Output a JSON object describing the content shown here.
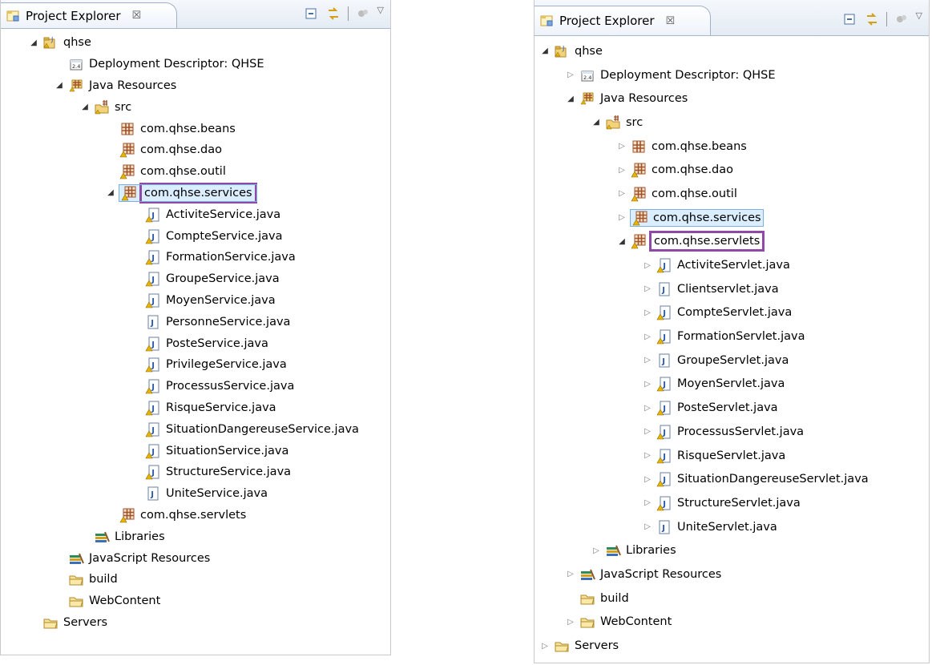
{
  "left_panel": {
    "tab_title": "Project Explorer",
    "tab_close": "☒",
    "tree": [
      {
        "level": 0,
        "toggle": "open",
        "icon": "project-icon",
        "label": "qhse"
      },
      {
        "level": 1,
        "toggle": "none",
        "icon": "deployment-descriptor-icon",
        "label": "Deployment Descriptor: QHSE"
      },
      {
        "level": 1,
        "toggle": "open",
        "icon": "java-resources-icon",
        "label": "Java Resources"
      },
      {
        "level": 2,
        "toggle": "open",
        "icon": "source-folder-icon",
        "label": "src"
      },
      {
        "level": 3,
        "toggle": "none",
        "icon": "package-icon",
        "label": "com.qhse.beans"
      },
      {
        "level": 3,
        "toggle": "none",
        "icon": "package-warning-icon",
        "label": "com.qhse.dao"
      },
      {
        "level": 3,
        "toggle": "none",
        "icon": "package-warning-icon",
        "label": "com.qhse.outil"
      },
      {
        "level": 3,
        "toggle": "open",
        "icon": "package-warning-icon",
        "label": "com.qhse.services",
        "selected": true,
        "highlight": true
      },
      {
        "level": 4,
        "toggle": "none",
        "icon": "java-file-warning-icon",
        "label": "ActiviteService.java"
      },
      {
        "level": 4,
        "toggle": "none",
        "icon": "java-file-warning-icon",
        "label": "CompteService.java"
      },
      {
        "level": 4,
        "toggle": "none",
        "icon": "java-file-warning-icon",
        "label": "FormationService.java"
      },
      {
        "level": 4,
        "toggle": "none",
        "icon": "java-file-warning-icon",
        "label": "GroupeService.java"
      },
      {
        "level": 4,
        "toggle": "none",
        "icon": "java-file-warning-icon",
        "label": "MoyenService.java"
      },
      {
        "level": 4,
        "toggle": "none",
        "icon": "java-file-icon",
        "label": "PersonneService.java"
      },
      {
        "level": 4,
        "toggle": "none",
        "icon": "java-file-warning-icon",
        "label": "PosteService.java"
      },
      {
        "level": 4,
        "toggle": "none",
        "icon": "java-file-warning-icon",
        "label": "PrivilegeService.java"
      },
      {
        "level": 4,
        "toggle": "none",
        "icon": "java-file-warning-icon",
        "label": "ProcessusService.java"
      },
      {
        "level": 4,
        "toggle": "none",
        "icon": "java-file-warning-icon",
        "label": "RisqueService.java"
      },
      {
        "level": 4,
        "toggle": "none",
        "icon": "java-file-warning-icon",
        "label": "SituationDangereuseService.java"
      },
      {
        "level": 4,
        "toggle": "none",
        "icon": "java-file-warning-icon",
        "label": "SituationService.java"
      },
      {
        "level": 4,
        "toggle": "none",
        "icon": "java-file-warning-icon",
        "label": "StructureService.java"
      },
      {
        "level": 4,
        "toggle": "none",
        "icon": "java-file-icon",
        "label": "UniteService.java"
      },
      {
        "level": 3,
        "toggle": "none",
        "icon": "package-warning-icon",
        "label": "com.qhse.servlets"
      },
      {
        "level": 2,
        "toggle": "none",
        "icon": "libraries-icon",
        "label": "Libraries"
      },
      {
        "level": 1,
        "toggle": "none",
        "icon": "libraries-icon",
        "label": "JavaScript Resources"
      },
      {
        "level": 1,
        "toggle": "none",
        "icon": "folder-icon",
        "label": "build"
      },
      {
        "level": 1,
        "toggle": "none",
        "icon": "folder-icon",
        "label": "WebContent"
      },
      {
        "level": 0,
        "toggle": "none",
        "icon": "folder-icon",
        "label": "Servers"
      }
    ]
  },
  "right_panel": {
    "tab_title": "Project Explorer",
    "tab_close": "☒",
    "tree": [
      {
        "level": 0,
        "toggle": "open",
        "icon": "project-icon",
        "label": "qhse"
      },
      {
        "level": 1,
        "toggle": "closed",
        "icon": "deployment-descriptor-icon",
        "label": "Deployment Descriptor: QHSE"
      },
      {
        "level": 1,
        "toggle": "open",
        "icon": "java-resources-icon",
        "label": "Java Resources"
      },
      {
        "level": 2,
        "toggle": "open",
        "icon": "source-folder-icon",
        "label": "src"
      },
      {
        "level": 3,
        "toggle": "closed",
        "icon": "package-icon",
        "label": "com.qhse.beans"
      },
      {
        "level": 3,
        "toggle": "closed",
        "icon": "package-warning-icon",
        "label": "com.qhse.dao"
      },
      {
        "level": 3,
        "toggle": "closed",
        "icon": "package-warning-icon",
        "label": "com.qhse.outil"
      },
      {
        "level": 3,
        "toggle": "closed",
        "icon": "package-warning-icon",
        "label": "com.qhse.services",
        "selected": true
      },
      {
        "level": 3,
        "toggle": "open",
        "icon": "package-warning-icon",
        "label": "com.qhse.servlets",
        "highlight": true
      },
      {
        "level": 4,
        "toggle": "closed",
        "icon": "java-file-warning-icon",
        "label": "ActiviteServlet.java"
      },
      {
        "level": 4,
        "toggle": "closed",
        "icon": "java-file-icon",
        "label": "Clientservlet.java"
      },
      {
        "level": 4,
        "toggle": "closed",
        "icon": "java-file-warning-icon",
        "label": "CompteServlet.java"
      },
      {
        "level": 4,
        "toggle": "closed",
        "icon": "java-file-warning-icon",
        "label": "FormationServlet.java"
      },
      {
        "level": 4,
        "toggle": "closed",
        "icon": "java-file-icon",
        "label": "GroupeServlet.java"
      },
      {
        "level": 4,
        "toggle": "closed",
        "icon": "java-file-warning-icon",
        "label": "MoyenServlet.java"
      },
      {
        "level": 4,
        "toggle": "closed",
        "icon": "java-file-warning-icon",
        "label": "PosteServlet.java"
      },
      {
        "level": 4,
        "toggle": "closed",
        "icon": "java-file-warning-icon",
        "label": "ProcessusServlet.java"
      },
      {
        "level": 4,
        "toggle": "closed",
        "icon": "java-file-warning-icon",
        "label": "RisqueServlet.java"
      },
      {
        "level": 4,
        "toggle": "closed",
        "icon": "java-file-warning-icon",
        "label": "SituationDangereuseServlet.java"
      },
      {
        "level": 4,
        "toggle": "closed",
        "icon": "java-file-warning-icon",
        "label": "StructureServlet.java"
      },
      {
        "level": 4,
        "toggle": "closed",
        "icon": "java-file-icon",
        "label": "UniteServlet.java"
      },
      {
        "level": 2,
        "toggle": "closed",
        "icon": "libraries-icon",
        "label": "Libraries"
      },
      {
        "level": 1,
        "toggle": "closed",
        "icon": "libraries-icon",
        "label": "JavaScript Resources"
      },
      {
        "level": 1,
        "toggle": "none",
        "icon": "folder-icon",
        "label": "build"
      },
      {
        "level": 1,
        "toggle": "closed",
        "icon": "folder-icon",
        "label": "WebContent"
      },
      {
        "level": 0,
        "toggle": "closed",
        "icon": "folder-icon",
        "label": "Servers"
      }
    ]
  },
  "colors": {
    "selection_fill": "#dbeeff",
    "selection_border": "#78b0e6",
    "highlight_box": "#8e4aa6",
    "package_brown": "#a0522d",
    "warning_yellow": "#e8b400"
  }
}
